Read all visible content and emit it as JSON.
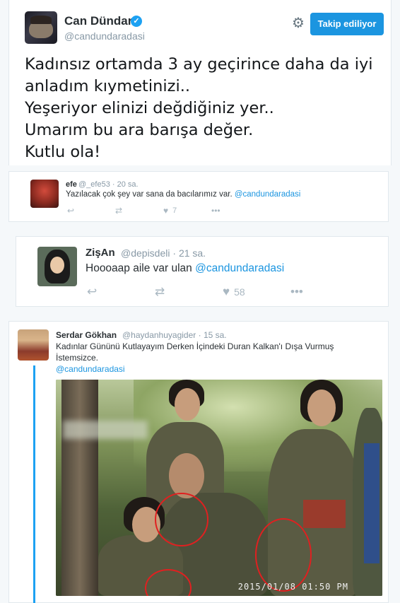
{
  "main_tweet": {
    "display_name": "Can Dündar",
    "verified": true,
    "handle": "@candundaradasi",
    "follow_button_label": "Takip ediliyor",
    "accent_color": "#1b95e0",
    "text_lines": [
      "Kadınsız ortamda 3 ay geçirince daha da  iyi",
      "anladım kıymetinizi..",
      "Yeşeriyor elinizi değdiğiniz yer..",
      "Umarım bu ara barışa değer.",
      "Kutlu ola!"
    ]
  },
  "replies": [
    {
      "display_name": "efe",
      "handle": "@_efe53",
      "time": "20 sa.",
      "text": "Yazılacak çok şey var sana da bacılarımız var.",
      "mention": "@candundaradasi",
      "likes": "7"
    },
    {
      "display_name": "ZişAn",
      "handle": "@depisdeli",
      "time": "21 sa.",
      "text": "Hoooaap aile var ulan",
      "mention": "@candundaradasi",
      "likes": "58"
    },
    {
      "display_name": "Serdar Gökhan",
      "handle": "@haydanhuyagider",
      "time": "15 sa.",
      "text": "Kadınlar Gününü Kutlayayım Derken İçindeki Duran Kalkan'ı Dışa Vurmuş İstemsizce.",
      "mention": "@candundaradasi",
      "photo_timestamp": "2015/01/08  01:50 PM"
    }
  ],
  "icons": {
    "reply": "reply-icon",
    "retweet": "retweet-icon",
    "like": "heart-icon",
    "more": "more-icon",
    "settings": "gear-icon",
    "verified": "verified-badge-icon"
  }
}
